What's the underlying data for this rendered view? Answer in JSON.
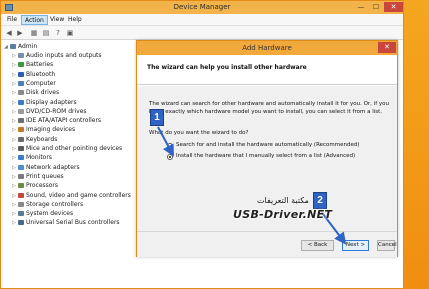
{
  "window": {
    "title": "Device Manager",
    "minimize": "—",
    "maximize": "☐",
    "close": "✕"
  },
  "menu": [
    "File",
    "Action",
    "View",
    "Help"
  ],
  "toolbar": [
    "◀",
    "▶",
    "▦",
    "▤",
    "?",
    "▣"
  ],
  "tree": {
    "root": "Admin",
    "items": [
      "Audio inputs and outputs",
      "Batteries",
      "Bluetooth",
      "Computer",
      "Disk drives",
      "Display adapters",
      "DVD/CD-ROM drives",
      "IDE ATA/ATAPI controllers",
      "Imaging devices",
      "Keyboards",
      "Mice and other pointing devices",
      "Monitors",
      "Network adapters",
      "Print queues",
      "Processors",
      "Sound, video and game controllers",
      "Storage controllers",
      "System devices",
      "Universal Serial Bus controllers"
    ],
    "colors": [
      "#7a8fa6",
      "#3c9a3c",
      "#2b5fb8",
      "#4f7fb8",
      "#8a8a8a",
      "#3b7bc8",
      "#9a9a9a",
      "#6f6f6f",
      "#c07a2a",
      "#6a6a6a",
      "#5a5a5a",
      "#3b7bc8",
      "#4f8fd0",
      "#7a7a7a",
      "#6a8a4a",
      "#c04a3a",
      "#8a8a8a",
      "#5a7a9a",
      "#4a6a8a"
    ]
  },
  "wizard": {
    "title": "Add Hardware",
    "close": "✕",
    "heading": "The wizard can help you install other hardware",
    "intro": "The wizard can search for other hardware and automatically install it for you. Or, if you know exactly which hardware model you want to install, you can select it from a list.",
    "question": "What do you want the wizard to do?",
    "options": [
      "Search for and install the hardware automatically (Recommended)",
      "Install the hardware that I manually select from a list (Advanced)"
    ],
    "selected_option": 1,
    "buttons": {
      "back": "< Back",
      "next": "Next >",
      "cancel": "Cancel"
    }
  },
  "annotations": {
    "step1": "1",
    "step2": "2"
  },
  "watermark": {
    "arabic": "مكتبة التعريفات",
    "site": "USB-Driver.NET"
  }
}
